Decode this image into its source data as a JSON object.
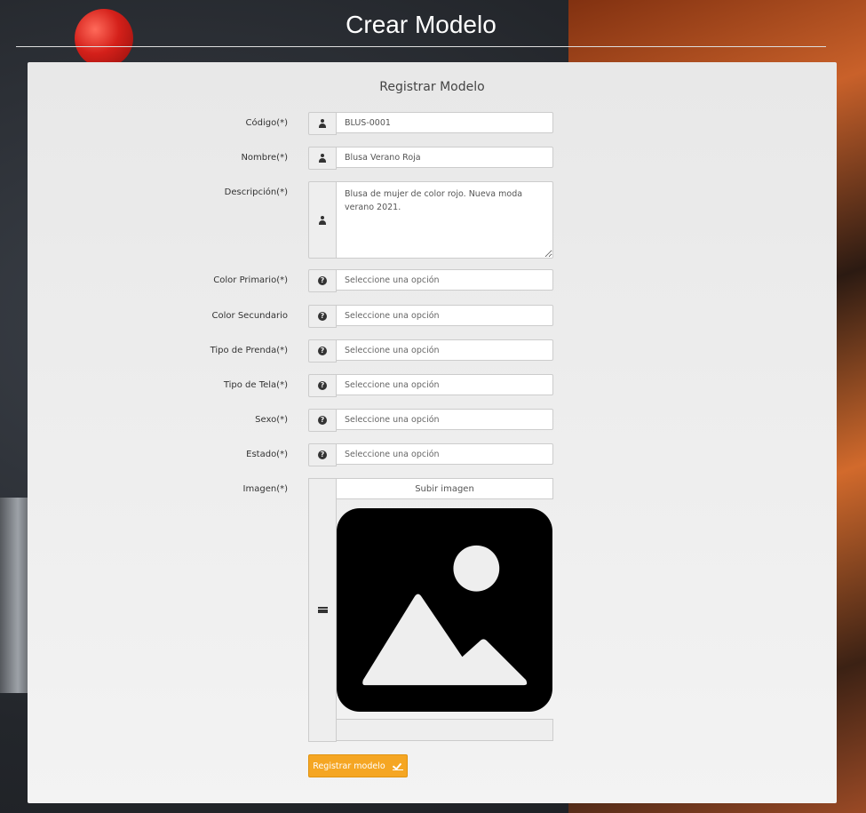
{
  "header": {
    "title": "Crear Modelo"
  },
  "panel": {
    "title": "Registrar Modelo"
  },
  "fields": {
    "codigo": {
      "label": "Código(*)",
      "value": "BLUS-0001"
    },
    "nombre": {
      "label": "Nombre(*)",
      "value": "Blusa Verano Roja"
    },
    "descripcion": {
      "label": "Descripción(*)",
      "value": "Blusa de mujer de color rojo. Nueva moda verano 2021."
    },
    "color_primario": {
      "label": "Color Primario(*)",
      "value": "Seleccione una opción"
    },
    "color_secundario": {
      "label": "Color Secundario",
      "value": "Seleccione una opción"
    },
    "tipo_prenda": {
      "label": "Tipo de Prenda(*)",
      "value": "Seleccione una opción"
    },
    "tipo_tela": {
      "label": "Tipo de Tela(*)",
      "value": "Seleccione una opción"
    },
    "sexo": {
      "label": "Sexo(*)",
      "value": "Seleccione una opción"
    },
    "estado": {
      "label": "Estado(*)",
      "value": "Seleccione una opción"
    },
    "imagen": {
      "label": "Imagen(*)",
      "upload_label": "Subir imagen"
    }
  },
  "submit": {
    "label": "Registrar modelo"
  },
  "icons": {
    "text_fields": "user-icon",
    "selects": "question-circle-icon",
    "image": "credit-card-icon",
    "submit": "check-icon"
  },
  "colors": {
    "accent": "#f5a623",
    "panel": "#ececec"
  }
}
